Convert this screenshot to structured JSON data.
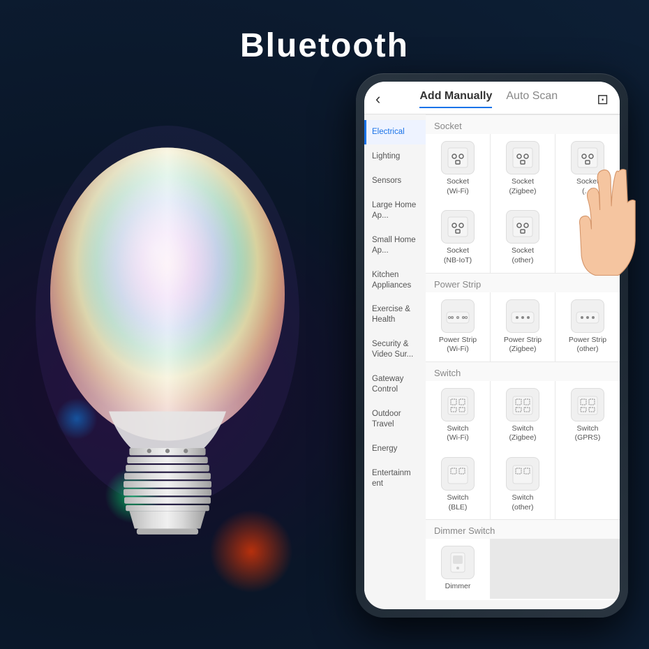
{
  "title": "Bluetooth",
  "header": {
    "tab_add_manually": "Add Manually",
    "tab_auto_scan": "Auto Scan"
  },
  "sidebar": {
    "items": [
      {
        "label": "Electrical",
        "active": true
      },
      {
        "label": "Lighting",
        "active": false
      },
      {
        "label": "Sensors",
        "active": false
      },
      {
        "label": "Large Home Ap...",
        "active": false
      },
      {
        "label": "Small Home Ap...",
        "active": false
      },
      {
        "label": "Kitchen Appliances",
        "active": false
      },
      {
        "label": "Exercise & Health",
        "active": false
      },
      {
        "label": "Security & Video Sur...",
        "active": false
      },
      {
        "label": "Gateway Control",
        "active": false
      },
      {
        "label": "Outdoor Travel",
        "active": false
      },
      {
        "label": "Energy",
        "active": false
      },
      {
        "label": "Entertainm ent",
        "active": false
      }
    ]
  },
  "sections": [
    {
      "label": "Socket",
      "devices": [
        {
          "name": "Socket (Wi-Fi)"
        },
        {
          "name": "Socket (Zigbee)"
        },
        {
          "name": "Socket (...)"
        }
      ]
    },
    {
      "label": "",
      "devices": [
        {
          "name": "Socket (NB-IoT)"
        },
        {
          "name": "Socket (other)"
        },
        {
          "name": ""
        }
      ]
    },
    {
      "label": "Power Strip",
      "devices": [
        {
          "name": "Power Strip (Wi-Fi)"
        },
        {
          "name": "Power Strip (Zigbee)"
        },
        {
          "name": "Power Strip (other)"
        }
      ]
    },
    {
      "label": "Switch",
      "devices": [
        {
          "name": "Switch (Wi-Fi)"
        },
        {
          "name": "Switch (Zigbee)"
        },
        {
          "name": "Switch (GPRS)"
        }
      ]
    },
    {
      "label": "",
      "devices": [
        {
          "name": "Switch (BLE)"
        },
        {
          "name": "Switch (other)"
        },
        {
          "name": ""
        }
      ]
    },
    {
      "label": "Dimmer Switch",
      "devices": []
    }
  ]
}
